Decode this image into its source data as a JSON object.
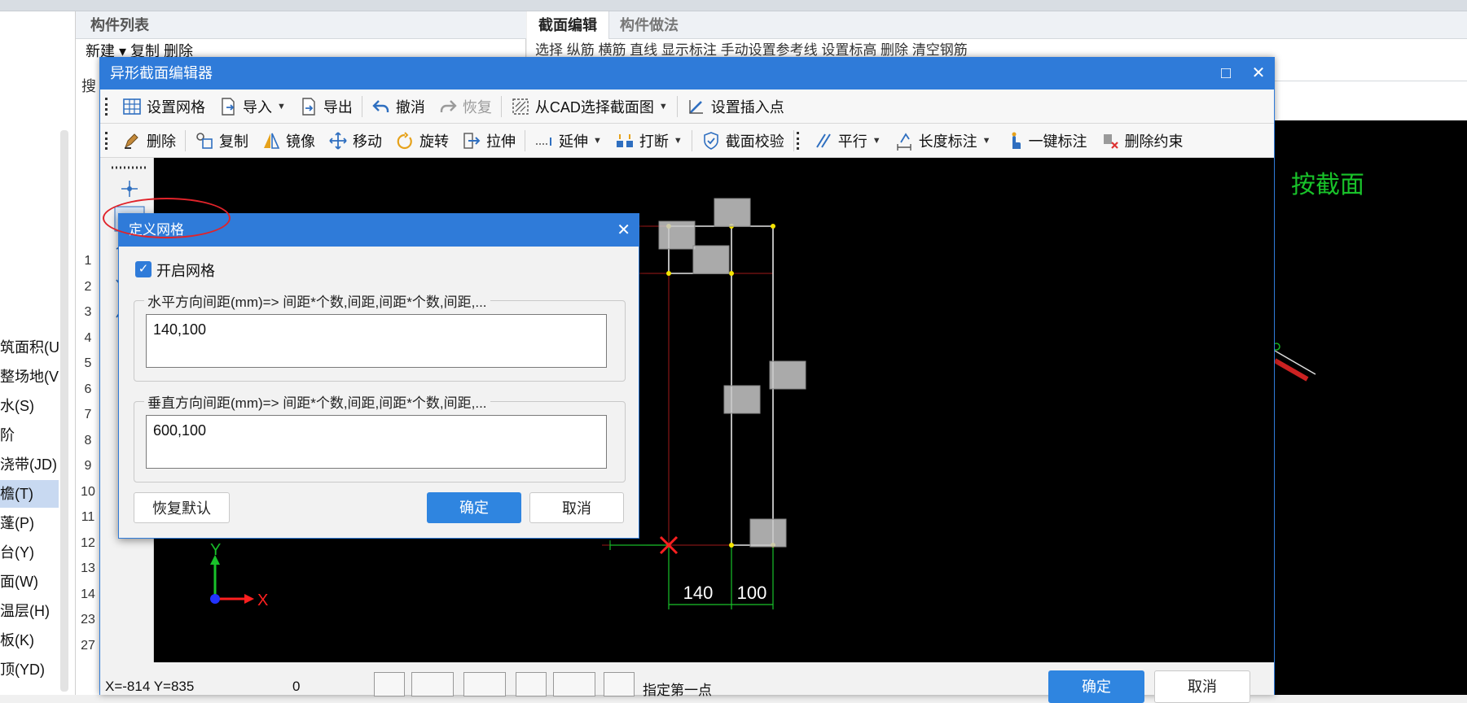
{
  "background": {
    "left_panel_items": [
      {
        "label": "筑面积(U"
      },
      {
        "label": "整场地(V"
      },
      {
        "label": "水(S)"
      },
      {
        "label": "阶"
      },
      {
        "label": "浇带(JD)"
      },
      {
        "label": "檐(T)",
        "selected": true
      },
      {
        "label": "蓬(P)"
      },
      {
        "label": "台(Y)"
      },
      {
        "label": "面(W)"
      },
      {
        "label": "温层(H)"
      },
      {
        "label": "板(K)"
      },
      {
        "label": "顶(YD)"
      }
    ],
    "component_list_header": "构件列表",
    "component_toolbar": "新建 ▾  复制  删除",
    "component_search_stub": "搜",
    "row_numbers": [
      "1",
      "2",
      "3",
      "4",
      "5",
      "6",
      "7",
      "8",
      "9",
      "10",
      "11",
      "12",
      "13",
      "14",
      "23",
      "27"
    ],
    "right_tabs": [
      "截面编辑",
      "构件做法"
    ],
    "right_toolbar_text": "选择  纵筋  横筋  直线  显示标注  手动设置参考线  设置标高  删除  清空钢筋",
    "canvas_text": "按截面"
  },
  "editor": {
    "title": "异形截面编辑器",
    "window_buttons": {
      "maximize": "□",
      "close": "✕"
    },
    "toolbar1": [
      {
        "label": "设置网格",
        "icon": "grid-icon"
      },
      {
        "label": "导入",
        "icon": "import-icon",
        "dropdown": true
      },
      {
        "label": "导出",
        "icon": "export-icon"
      },
      {
        "label": "撤消",
        "icon": "undo-icon"
      },
      {
        "label": "恢复",
        "icon": "redo-icon",
        "disabled": true
      },
      {
        "label": "从CAD选择截面图",
        "icon": "cad-select-icon",
        "dropdown": true
      },
      {
        "label": "设置插入点",
        "icon": "insert-point-icon"
      }
    ],
    "toolbar2": [
      {
        "label": "删除",
        "icon": "delete-icon"
      },
      {
        "label": "复制",
        "icon": "copy-icon"
      },
      {
        "label": "镜像",
        "icon": "mirror-icon"
      },
      {
        "label": "移动",
        "icon": "move-icon"
      },
      {
        "label": "旋转",
        "icon": "rotate-icon"
      },
      {
        "label": "拉伸",
        "icon": "stretch-icon"
      },
      {
        "label": "延伸",
        "icon": "extend-icon",
        "dropdown": true
      },
      {
        "label": "打断",
        "icon": "break-icon",
        "dropdown": true
      },
      {
        "label": "截面校验",
        "icon": "check-icon"
      },
      {
        "label": "平行",
        "icon": "parallel-icon",
        "dropdown": true
      },
      {
        "label": "长度标注",
        "icon": "dimension-icon",
        "dropdown": true
      },
      {
        "label": "一键标注",
        "icon": "auto-dimension-icon"
      },
      {
        "label": "删除约束",
        "icon": "remove-constraint-icon"
      }
    ],
    "dimension_labels": [
      "140",
      "100"
    ],
    "axis_labels": {
      "x": "X",
      "y": "Y"
    },
    "status": {
      "coords": "X=-814 Y=835",
      "value": "0",
      "prompt": "指定第一点"
    },
    "confirm_label": "确定",
    "cancel_label": "取消",
    "colors": {
      "accent": "#2f7bd9",
      "canvas": "#000000",
      "grid_red": "#e0232a",
      "snap_yellow": "#f5e400"
    }
  },
  "grid_dialog": {
    "title": "定义网格",
    "close": "✕",
    "enable_label": "开启网格",
    "enabled": true,
    "horizontal_legend": "水平方向间距(mm)=> 间距*个数,间距,间距*个数,间距,...",
    "horizontal_value": "140,100",
    "vertical_legend": "垂直方向间距(mm)=> 间距*个数,间距,间距*个数,间距,...",
    "vertical_value": "600,100",
    "reset_label": "恢复默认",
    "ok_label": "确定",
    "cancel_label": "取消"
  }
}
